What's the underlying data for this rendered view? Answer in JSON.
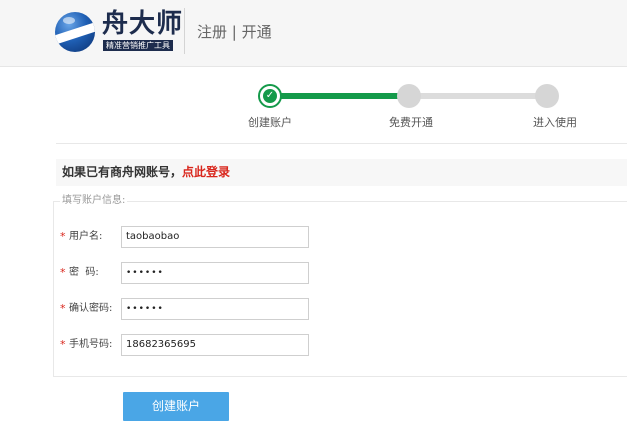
{
  "header": {
    "logo_name": "舟大师",
    "logo_tagline": "精准营销推广工具",
    "title": "注册 | 开通"
  },
  "steps": [
    {
      "label": "创建账户",
      "status": "active",
      "icon": "check-icon"
    },
    {
      "label": "免费开通",
      "status": "pending"
    },
    {
      "label": "进入使用",
      "status": "pending"
    }
  ],
  "login_tip": {
    "text": "如果已有商舟网账号",
    "comma": "，",
    "link_label": "点此登录",
    "link_color": "#d9261c"
  },
  "form": {
    "legend": "填写账户信息:",
    "fields": [
      {
        "label": "用户名:",
        "value": "taobaobao",
        "required": true
      },
      {
        "label": "密  码:",
        "value": "••••••",
        "required": true
      },
      {
        "label": "确认密码:",
        "value": "••••••",
        "required": true
      },
      {
        "label": "手机号码:",
        "value": "18682365695",
        "required": true
      }
    ],
    "required_mark": "*",
    "submit_label": "创建账户"
  },
  "colors": {
    "progress_done": "#149a4a",
    "progress_todo": "#dcdcdc",
    "button": "#4aa6e6",
    "required": "#d9261c"
  }
}
